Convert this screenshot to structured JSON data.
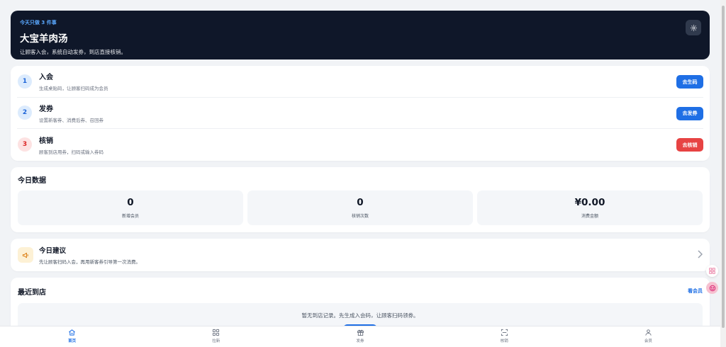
{
  "hero": {
    "tag": "今天只做 3 件事",
    "title": "大宝羊肉汤",
    "subtitle": "让顾客入会，系统自动发券，到店直接核销。",
    "settings_icon": "gear-icon"
  },
  "steps": [
    {
      "num": "1",
      "title": "入会",
      "desc": "生成桌贴码，让顾客扫码成为会员",
      "button": "去生码",
      "color": "blue"
    },
    {
      "num": "2",
      "title": "发券",
      "desc": "设置新客券、消费后券、召回券",
      "button": "去发券",
      "color": "blue"
    },
    {
      "num": "3",
      "title": "核销",
      "desc": "顾客到店用券，扫码或输入券码",
      "button": "去核销",
      "color": "red"
    }
  ],
  "today": {
    "title": "今日数据",
    "stats": [
      {
        "value": "0",
        "label": "新增会员"
      },
      {
        "value": "0",
        "label": "核销次数"
      },
      {
        "value": "¥0.00",
        "label": "消费金额"
      }
    ]
  },
  "advice": {
    "title": "今日建议",
    "desc": "先让顾客扫码入会，再用新客券引导第一次消费。",
    "icon": "megaphone-icon"
  },
  "recent": {
    "title": "最近到店",
    "link": "看会员",
    "empty_text": "暂无到店记录。先生成入会码，让顾客扫码领券。"
  },
  "tabs": [
    {
      "label": "首页",
      "icon": "home-icon",
      "active": true
    },
    {
      "label": "拉新",
      "icon": "grid-icon",
      "active": false
    },
    {
      "label": "发券",
      "icon": "gift-icon",
      "active": false
    },
    {
      "label": "核销",
      "icon": "scan-icon",
      "active": false
    },
    {
      "label": "会员",
      "icon": "user-icon",
      "active": false
    }
  ],
  "colors": {
    "primary": "#1f6fe5",
    "danger": "#e74343",
    "hero_bg": "#0f1729",
    "page_bg": "#f1f3f6"
  }
}
